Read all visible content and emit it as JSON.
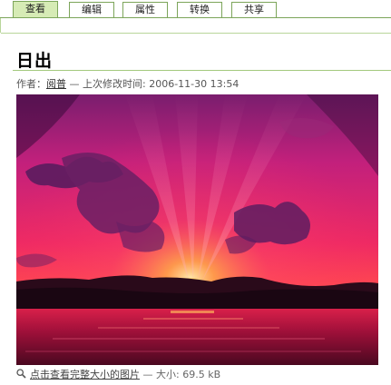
{
  "tabs": [
    {
      "label": "查看",
      "active": true
    },
    {
      "label": "编辑",
      "active": false
    },
    {
      "label": "属性",
      "active": false
    },
    {
      "label": "转换",
      "active": false
    },
    {
      "label": "共享",
      "active": false
    }
  ],
  "page": {
    "title": "日出"
  },
  "meta": {
    "author_label": "作者：",
    "author_name": "阅普",
    "separator": " — ",
    "modified_label": "上次修改时间:",
    "modified_time": "2006-11-30 13:54"
  },
  "footer": {
    "link_text": "点击查看完整大小的图片",
    "separator": " — ",
    "size_label": "大小:",
    "size_value": "69.5 kB"
  },
  "colors": {
    "tab_border": "#7ca55a",
    "tab_active_bg": "#d6ebb5",
    "rule": "#a3c97e"
  },
  "icons": {
    "footer_icon": "magnifier-icon"
  }
}
